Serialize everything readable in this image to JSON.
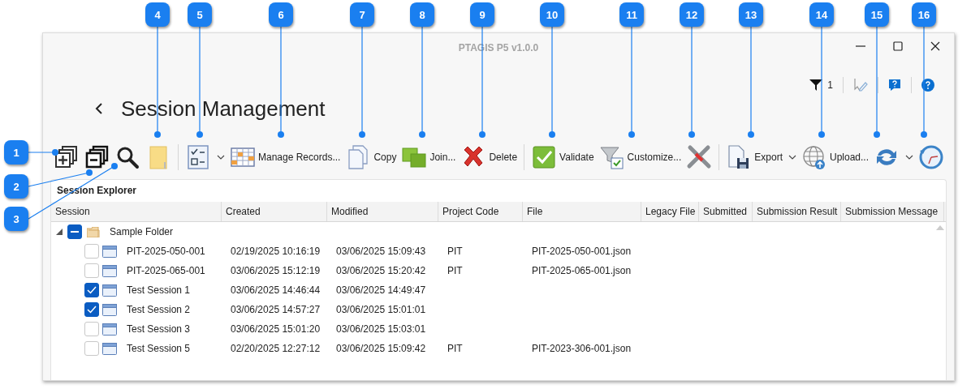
{
  "window": {
    "title": "PTAGIS P5 v1.0.0"
  },
  "header": {
    "title": "Session Management",
    "filter_count": "1"
  },
  "toolbar": [
    {
      "kind": "expand"
    },
    {
      "kind": "collapse"
    },
    {
      "kind": "search"
    },
    {
      "kind": "folder"
    },
    {
      "kind": "separator"
    },
    {
      "kind": "checklist",
      "dropdown": true
    },
    {
      "kind": "grid",
      "label": "Manage Records..."
    },
    {
      "kind": "copy",
      "label": "Copy"
    },
    {
      "kind": "join",
      "label": "Join..."
    },
    {
      "kind": "delete",
      "label": "Delete"
    },
    {
      "kind": "separator"
    },
    {
      "kind": "validate",
      "label": "Validate"
    },
    {
      "kind": "customize",
      "label": "Customize..."
    },
    {
      "kind": "tools"
    },
    {
      "kind": "separator"
    },
    {
      "kind": "export",
      "label": "Export",
      "dropdown": true
    },
    {
      "kind": "upload",
      "label": "Upload..."
    },
    {
      "kind": "sync",
      "dropdown": true
    },
    {
      "kind": "history"
    }
  ],
  "explorer": {
    "title": "Session Explorer",
    "columns": [
      "Session",
      "Created",
      "Modified",
      "Project Code",
      "File",
      "Legacy File",
      "Submitted",
      "Submission Result",
      "Submission Message"
    ],
    "tree": {
      "label": "Sample Folder",
      "expanded": true,
      "partial": true,
      "children": [
        {
          "checked": false,
          "session": "PIT-2025-050-001",
          "created": "02/19/2025 10:16:19",
          "modified": "03/06/2025 15:09:43",
          "project_code": "PIT",
          "file": "PIT-2025-050-001.json"
        },
        {
          "checked": false,
          "session": "PIT-2025-065-001",
          "created": "03/06/2025 15:12:19",
          "modified": "03/06/2025 15:20:42",
          "project_code": "PIT",
          "file": "PIT-2025-065-001.json"
        },
        {
          "checked": true,
          "session": "Test Session 1",
          "created": "03/06/2025 14:46:44",
          "modified": "03/06/2025 14:49:47"
        },
        {
          "checked": true,
          "session": "Test Session 2",
          "created": "03/06/2025 14:57:27",
          "modified": "03/06/2025 15:01:01"
        },
        {
          "checked": false,
          "session": "Test Session 3",
          "created": "03/06/2025 15:01:20",
          "modified": "03/06/2025 15:03:01"
        },
        {
          "checked": false,
          "session": "Test Session 5",
          "created": "02/20/2025 12:27:12",
          "modified": "03/06/2025 15:09:42",
          "project_code": "PIT",
          "file": "PIT-2023-306-001.json"
        }
      ]
    }
  },
  "callouts": [
    {
      "number": "1"
    },
    {
      "number": "2"
    },
    {
      "number": "3"
    },
    {
      "number": "4"
    },
    {
      "number": "5"
    },
    {
      "number": "6"
    },
    {
      "number": "7"
    },
    {
      "number": "8"
    },
    {
      "number": "9"
    },
    {
      "number": "10"
    },
    {
      "number": "11"
    },
    {
      "number": "12"
    },
    {
      "number": "13"
    },
    {
      "number": "14"
    },
    {
      "number": "15"
    },
    {
      "number": "16"
    }
  ]
}
